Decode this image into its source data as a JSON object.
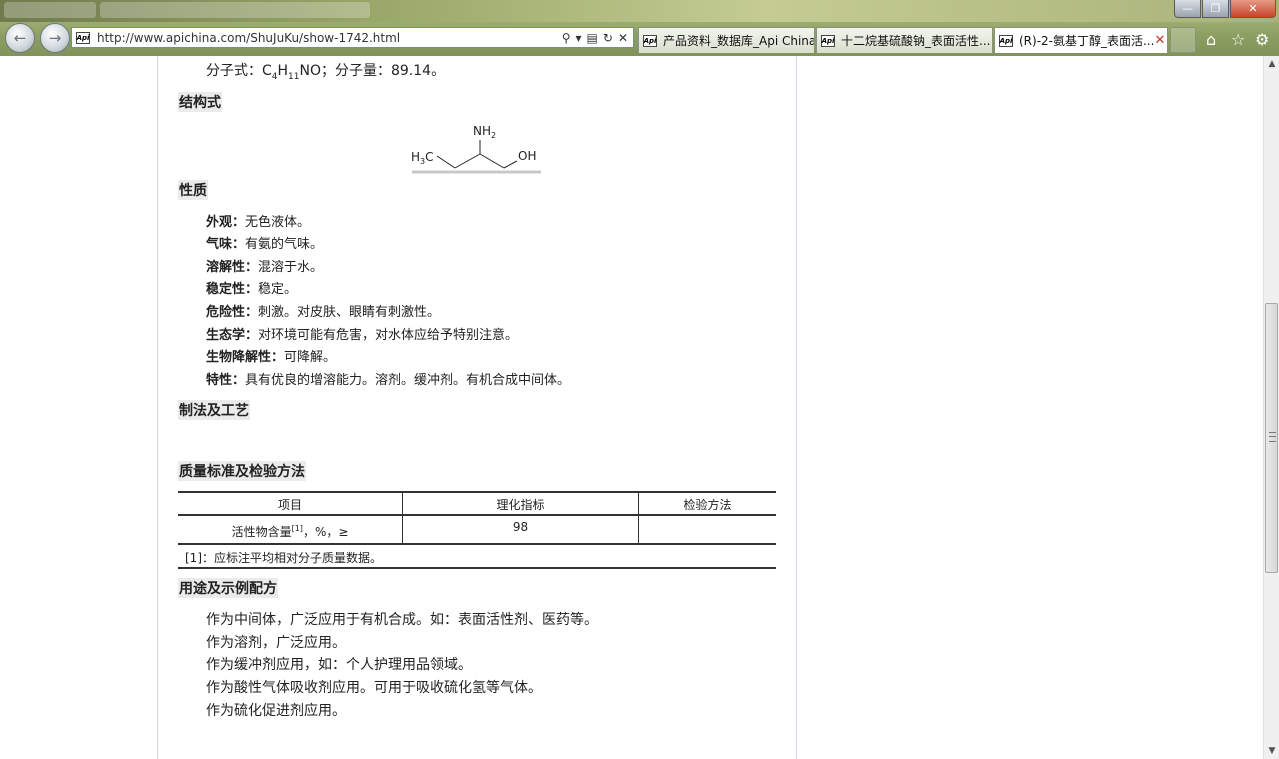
{
  "browser": {
    "url": "http://www.apichina.com/ShuJuKu/show-1742.html",
    "tab_icon_label": "Api",
    "tabs": [
      {
        "label": "产品资料_数据库_Api China"
      },
      {
        "label": "十二烷基硫酸钠_表面活性..."
      },
      {
        "label": "(R)-2-氨基丁醇_表面活..."
      }
    ],
    "win_min": "—",
    "win_max": "❐",
    "win_close": "✕"
  },
  "article": {
    "formula_prefix": "分子式：C",
    "formula_sub1": "4",
    "formula_h": "H",
    "formula_sub2": "11",
    "formula_suffix": "NO；分子量：89.14。",
    "structure_heading": "结构式",
    "structure": {
      "nh2_n": "NH",
      "nh2_sub": "2",
      "h3c_h": "H",
      "h3c_sub": "3",
      "h3c_c": "C",
      "oh": "OH"
    },
    "properties_heading": "性质",
    "properties": [
      {
        "label": "外观：",
        "value": "无色液体。"
      },
      {
        "label": "气味：",
        "value": "有氨的气味。"
      },
      {
        "label": "溶解性：",
        "value": "混溶于水。"
      },
      {
        "label": "稳定性：",
        "value": "稳定。"
      },
      {
        "label": "危险性：",
        "value": "刺激。对皮肤、眼睛有刺激性。"
      },
      {
        "label": "生态学：",
        "value": "对环境可能有危害，对水体应给予特别注意。"
      },
      {
        "label": "生物降解性：",
        "value": "可降解。"
      },
      {
        "label": "特性：",
        "value": "具有优良的增溶能力。溶剂。缓冲剂。有机合成中间体。"
      }
    ],
    "process_heading": "制法及工艺",
    "quality_heading": "质量标准及检验方法",
    "quality_table": {
      "headers": [
        "项目",
        "理化指标",
        "检验方法"
      ],
      "row_item": "活性物含量",
      "row_item_sup": "[1]",
      "row_item_suffix": "，%，≥",
      "row_value": "98",
      "row_method": "",
      "footnote": "[1]：应标注平均相对分子质量数据。"
    },
    "uses_heading": "用途及示例配方",
    "uses": [
      "作为中间体，广泛应用于有机合成。如：表面活性剂、医药等。",
      "作为溶剂，广泛应用。",
      "作为缓冲剂应用，如：个人护理用品领域。",
      "作为酸性气体吸收剂应用。可用于吸收硫化氢等气体。",
      "作为硫化促进剂应用。"
    ]
  }
}
